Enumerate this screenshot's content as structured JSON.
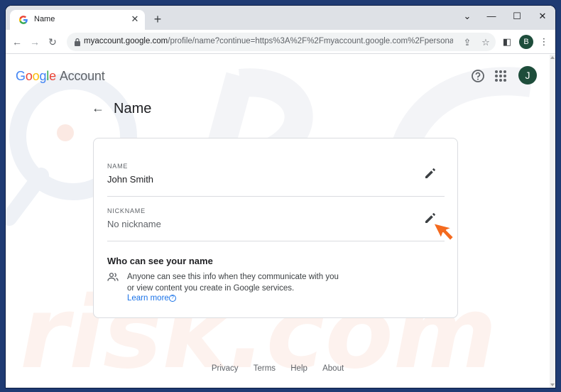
{
  "browser": {
    "tab_title": "Name",
    "url_host": "myaccount.google.com",
    "url_rest": "/profile/name?continue=https%3A%2F%2Fmyaccount.google.com%2Fpersonal-info...",
    "profile_initial": "B"
  },
  "header": {
    "brand_word": [
      "G",
      "o",
      "o",
      "g",
      "l",
      "e"
    ],
    "brand_suffix": "Account",
    "avatar_initial": "J"
  },
  "page": {
    "title": "Name"
  },
  "card": {
    "name_label": "NAME",
    "name_value": "John Smith",
    "nickname_label": "NICKNAME",
    "nickname_value": "No nickname",
    "who_title": "Who can see your name",
    "who_text": "Anyone can see this info when they communicate with you or view content you create in Google services.",
    "learn_more": "Learn more"
  },
  "footer": {
    "links": [
      "Privacy",
      "Terms",
      "Help",
      "About"
    ]
  },
  "colors": {
    "accent": "#1a73e8",
    "avatar_bg": "#1e4d3b",
    "cursor": "#f46a1e"
  }
}
